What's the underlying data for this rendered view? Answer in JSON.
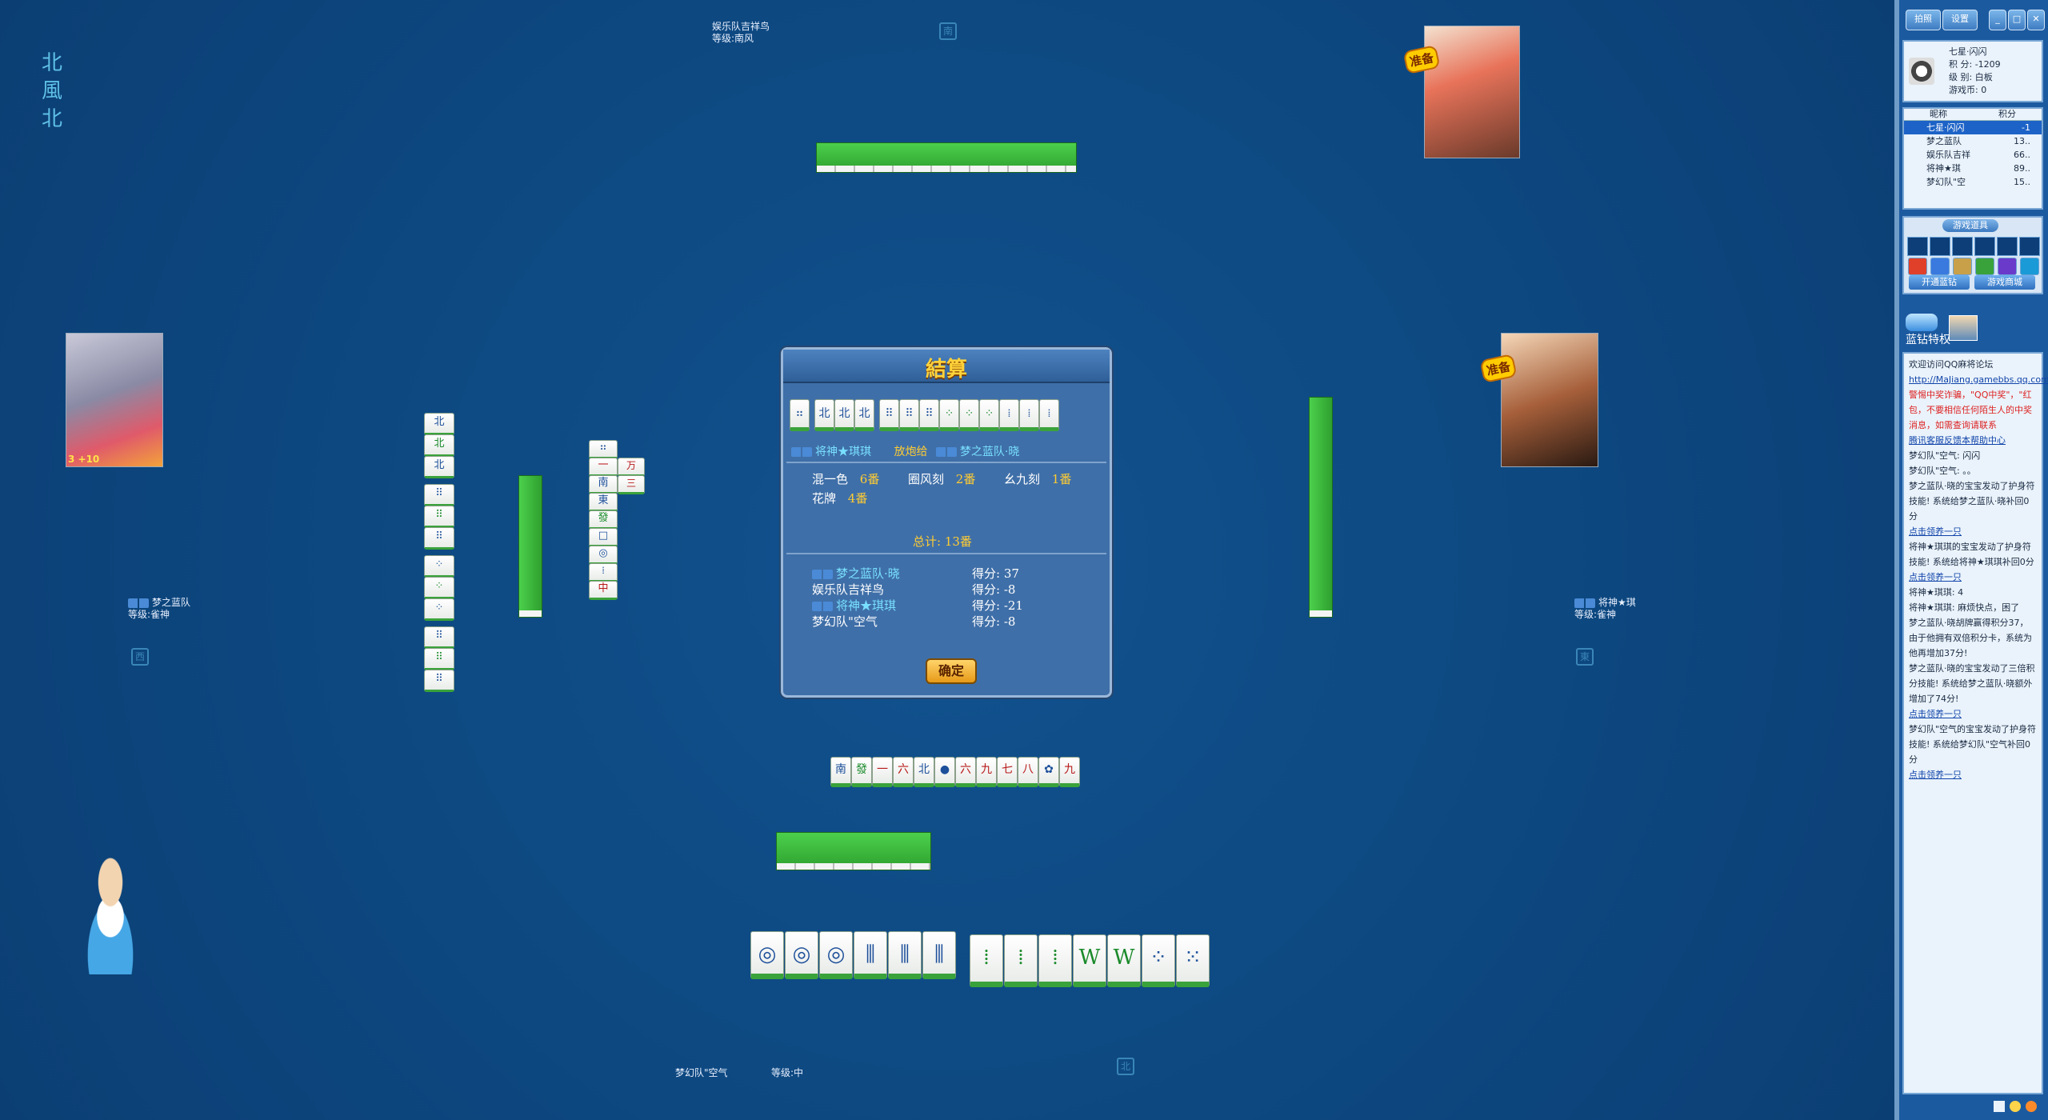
{
  "round": {
    "chars": [
      "北",
      "風",
      "北"
    ]
  },
  "seats": {
    "top": {
      "name": "娱乐队吉祥鸟",
      "level_text": "等级:南风",
      "ready": "准备"
    },
    "left": {
      "name": "梦之蓝队",
      "level_text": "等级:雀神",
      "badge": "3 +10"
    },
    "right": {
      "name": "将神★琪",
      "level_text": "等级:雀神",
      "ready": "准备"
    },
    "bottom": {
      "name": "梦幻队\"空气",
      "level_text": "等级:中"
    }
  },
  "compass_labels": {
    "top": "南",
    "left": "西",
    "right": "東",
    "bottom": "北"
  },
  "dialog": {
    "title": "結算",
    "hand_tiles": [
      "⠶",
      "北",
      "北",
      "北",
      "⠿",
      "⠿",
      "⠿",
      "⁘",
      "⁘",
      "⁘",
      "⁞",
      "⁞",
      "⁞"
    ],
    "winner": "将神★琪琪",
    "action": "放炮给",
    "loser": "梦之蓝队·晓",
    "fan_items": [
      {
        "name": "混一色",
        "fan": "6番"
      },
      {
        "name": "圈风刻",
        "fan": "2番"
      },
      {
        "name": "幺九刻",
        "fan": "1番"
      },
      {
        "name": "花牌",
        "fan": "4番"
      }
    ],
    "total": "总计: 13番",
    "scores": [
      {
        "name": "梦之蓝队·晓",
        "score": "得分: 37"
      },
      {
        "name": "娱乐队吉祥鸟",
        "score": "得分: -8"
      },
      {
        "name": "将神★琪琪",
        "score": "得分: -21"
      },
      {
        "name": "梦幻队\"空气",
        "score": "得分: -8"
      }
    ],
    "ok_label": "确定"
  },
  "discards_center": [
    "南",
    "發",
    "一",
    "六",
    "北",
    "●",
    "六",
    "九",
    "七",
    "八",
    "✿",
    "九"
  ],
  "my_hand": [
    "◎",
    "◎",
    "◎",
    "⫼",
    "⫼",
    "⫼",
    "⁞",
    "⁞",
    "⁞",
    "W",
    "W",
    "⁘",
    "⁙"
  ],
  "left_melds": [
    "北",
    "北",
    "北",
    "⠿",
    "⠿",
    "⠿",
    "⁘",
    "⁘",
    "⁘",
    "⠿",
    "⠿",
    "⠿"
  ],
  "left_discards": [
    "⠶",
    "一",
    "南",
    "東",
    "發",
    "□",
    "◎",
    "⁞",
    "中"
  ],
  "left_discards_side": [
    "万",
    "三"
  ],
  "sidebar": {
    "top_buttons": [
      "拍照",
      "设置",
      "_",
      "□",
      "✕"
    ],
    "user": {
      "name": "七星·闪闪",
      "score": "积  分: -1209",
      "level": "级  别: 白板",
      "coins": "游戏币: 0"
    },
    "list_header": [
      "昵称",
      "积分"
    ],
    "players": [
      {
        "name": "七星·闪闪",
        "score": "-1"
      },
      {
        "name": "梦之蓝队",
        "score": "13.."
      },
      {
        "name": "娱乐队吉祥",
        "score": "66.."
      },
      {
        "name": "将神★琪",
        "score": "89.."
      },
      {
        "name": "梦幻队\"空",
        "score": "15.."
      }
    ],
    "props_title": "游戏道具",
    "open_blue": "开通蓝钻",
    "shop": "游戏商城",
    "vip": "蓝钻特权",
    "chat": [
      {
        "type": "normal",
        "text": "欢迎访问QQ麻将论坛 "
      },
      {
        "type": "link",
        "text": "http://MaJiang.gamebbs.qq.com"
      },
      {
        "type": "red",
        "text": "警惕中奖诈骗，\"QQ中奖\"，\"红包，不要相信任何陌生人的中奖消息，如需查询请联系"
      },
      {
        "type": "link",
        "text": "腾讯客服反馈本帮助中心"
      },
      {
        "type": "normal",
        "text": "梦幻队\"空气: 闪闪"
      },
      {
        "type": "normal",
        "text": "梦幻队\"空气: 。。"
      },
      {
        "type": "normal",
        "text": "梦之蓝队·晓的宝宝发动了护身符技能! 系统给梦之蓝队·晓补回0分"
      },
      {
        "type": "link",
        "text": "点击领养一只"
      },
      {
        "type": "normal",
        "text": "将神★琪琪的宝宝发动了护身符技能! 系统给将神★琪琪补回0分"
      },
      {
        "type": "link",
        "text": "点击领养一只"
      },
      {
        "type": "normal",
        "text": "将神★琪琪: 4"
      },
      {
        "type": "normal",
        "text": "将神★琪琪: 麻烦快点，困了"
      },
      {
        "type": "normal",
        "text": "梦之蓝队·晓胡牌赢得积分37，由于他拥有双倍积分卡，系统为他再增加37分!"
      },
      {
        "type": "normal",
        "text": "梦之蓝队·晓的宝宝发动了三倍积分技能! 系统给梦之蓝队·晓额外增加了74分!"
      },
      {
        "type": "link",
        "text": "点击领养一只"
      },
      {
        "type": "normal",
        "text": "梦幻队\"空气的宝宝发动了护身符技能! 系统给梦幻队\"空气补回0分"
      },
      {
        "type": "link",
        "text": "点击领养一只"
      }
    ]
  },
  "colors": {
    "table": "#0e4a83",
    "wall_green": "#3cbf3c",
    "gold": "#ffcc33"
  }
}
